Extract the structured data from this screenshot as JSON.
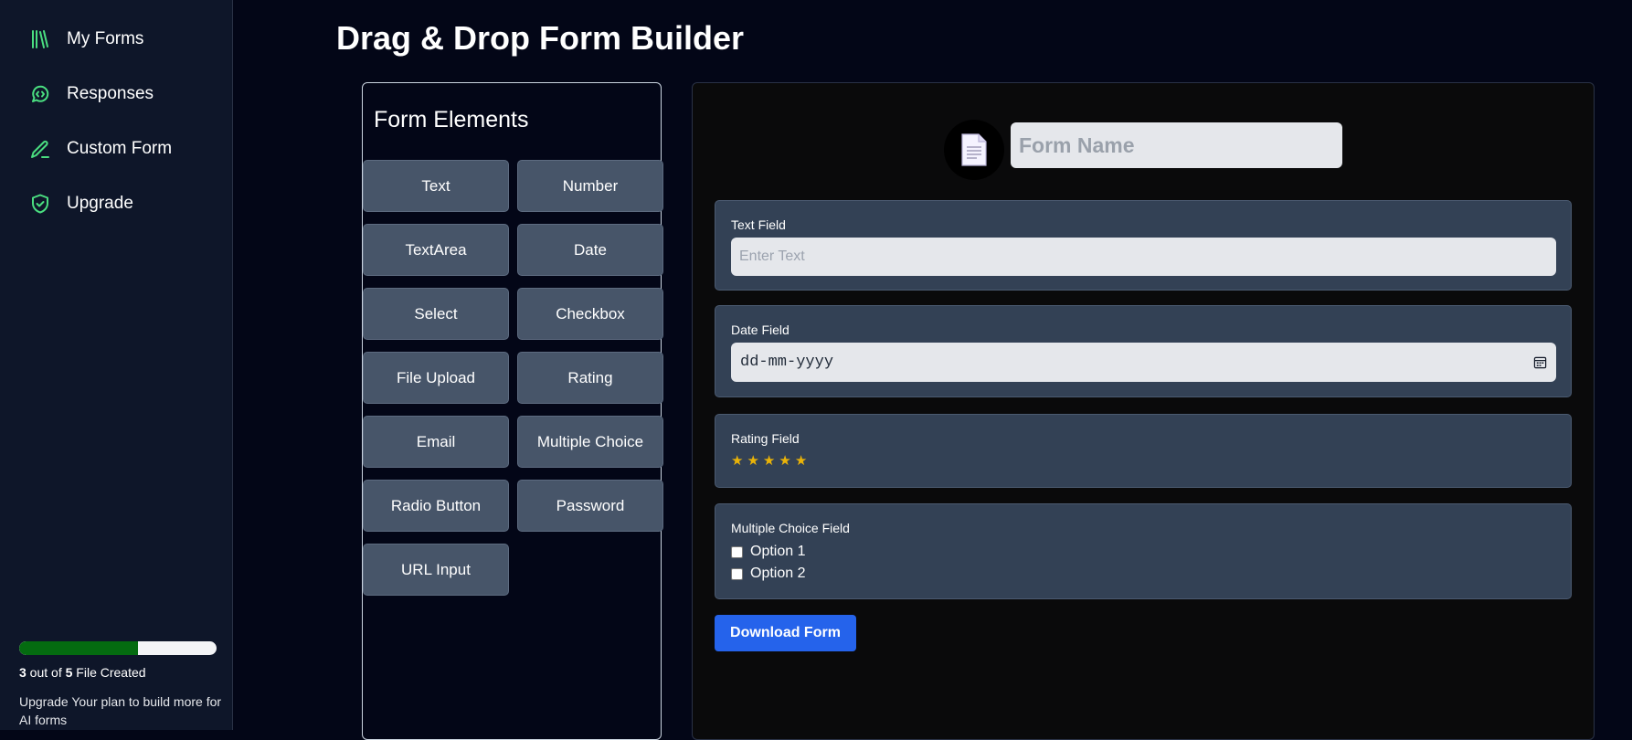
{
  "sidebar": {
    "items": [
      {
        "label": "My Forms",
        "icon": "library-icon"
      },
      {
        "label": "Responses",
        "icon": "message-code-icon"
      },
      {
        "label": "Custom Form",
        "icon": "pencil-icon"
      },
      {
        "label": "Upgrade",
        "icon": "shield-check-icon"
      }
    ],
    "progress": {
      "created": "3",
      "total": "5",
      "fraction": 0.6,
      "text_middle": " out of ",
      "text_suffix": " File Created"
    },
    "upgrade_note": "Upgrade Your plan to build more for AI forms"
  },
  "page": {
    "title": "Drag & Drop Form Builder"
  },
  "elements_panel": {
    "title": "Form Elements",
    "buttons": [
      "Text",
      "Number",
      "TextArea",
      "Date",
      "Select",
      "Checkbox",
      "File Upload",
      "Rating",
      "Email",
      "Multiple Choice",
      "Radio Button",
      "Password",
      "URL Input"
    ]
  },
  "builder": {
    "form_name_placeholder": "Form Name",
    "text_field": {
      "label": "Text Field",
      "placeholder": "Enter Text"
    },
    "date_field": {
      "label": "Date Field",
      "value": "dd-mm-yyyy"
    },
    "rating_field": {
      "label": "Rating Field",
      "stars": 5
    },
    "multiple_choice_field": {
      "label": "Multiple Choice Field",
      "options": [
        "Option 1",
        "Option 2"
      ]
    },
    "download_label": "Download Form"
  },
  "colors": {
    "accent_green": "#4ade80",
    "progress_fill": "#046b10",
    "star": "#eab308",
    "primary_button": "#2563eb"
  }
}
